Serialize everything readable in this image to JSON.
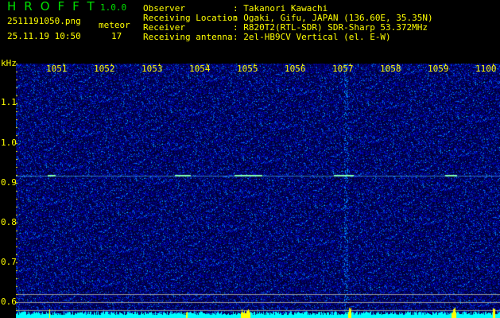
{
  "app": {
    "title": "HROFFT",
    "version": "1.0.0"
  },
  "file": {
    "name": "2511191050.png",
    "datetime": "25.11.19 10:50"
  },
  "meteor": {
    "label": "meteor",
    "count": "17"
  },
  "info": [
    {
      "label": "Observer",
      "value": "Takanori Kawachi"
    },
    {
      "label": "Receiving Location",
      "value": "Ogaki, Gifu, JAPAN (136.60E, 35.35N)"
    },
    {
      "label": "Receiver",
      "value": "R820T2(RTL-SDR) SDR-Sharp 53.372MHz"
    },
    {
      "label": "Receiving antenna",
      "value": "2el-HB9CV Vertical (el. E-W)"
    }
  ],
  "axis": {
    "unit": "kHz",
    "y_ticks": [
      "1.1",
      "1.0",
      "0.9",
      "0.8",
      "0.7",
      "0.6"
    ],
    "time_ticks": [
      "1051",
      "1052",
      "1053",
      "1054",
      "1055",
      "1056",
      "1057",
      "1058",
      "1059",
      "1100"
    ]
  },
  "colors": {
    "text": "#ffff00",
    "title": "#00e000",
    "level": "#00ffff",
    "level_peak": "#ffff00"
  }
}
